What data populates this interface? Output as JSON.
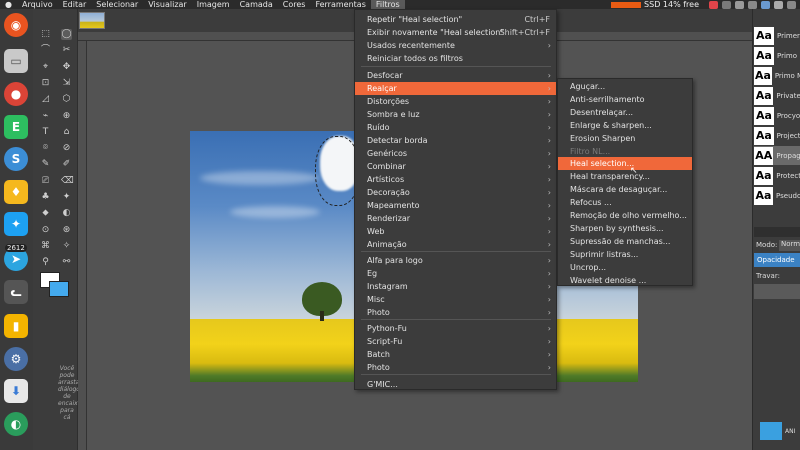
{
  "menubar": {
    "items": [
      "Arquivo",
      "Editar",
      "Selecionar",
      "Visualizar",
      "Imagem",
      "Camada",
      "Cores",
      "Ferramentas",
      "Filtros"
    ],
    "active": "Filtros"
  },
  "system": {
    "ssd_label": "SSD 14% free",
    "ssd_color": "#e85b13"
  },
  "launcher": {
    "apps": [
      "ubuntu-logo-icon",
      "files-icon",
      "chrome-icon",
      "evernote-icon",
      "simplenote-icon",
      "lightbulb-icon",
      "twitter-icon",
      "telegram-icon",
      "cat-icon",
      "slides-icon",
      "settings-icon",
      "install-icon",
      "sound-icon"
    ],
    "telegram_badge": "2612"
  },
  "toolbox": {
    "tip": "Você pode arrastar diálogos de encaixe para cá"
  },
  "filters_menu": {
    "items": [
      {
        "label": "Repetir \"Heal selection\"",
        "shortcut": "Ctrl+F",
        "submenu": false
      },
      {
        "label": "Exibir novamente \"Heal selection\"",
        "shortcut": "Shift+Ctrl+F",
        "submenu": false
      },
      {
        "label": "Usados recentemente",
        "shortcut": "",
        "submenu": true
      },
      {
        "label": "Reiniciar todos os filtros",
        "shortcut": "",
        "submenu": false
      },
      {
        "label": "Desfocar",
        "shortcut": "",
        "submenu": true
      },
      {
        "label": "Realçar",
        "shortcut": "",
        "submenu": true,
        "highlighted": true
      },
      {
        "label": "Distorções",
        "shortcut": "",
        "submenu": true
      },
      {
        "label": "Sombra e luz",
        "shortcut": "",
        "submenu": true
      },
      {
        "label": "Ruído",
        "shortcut": "",
        "submenu": true
      },
      {
        "label": "Detectar borda",
        "shortcut": "",
        "submenu": true
      },
      {
        "label": "Genéricos",
        "shortcut": "",
        "submenu": true
      },
      {
        "label": "Combinar",
        "shortcut": "",
        "submenu": true
      },
      {
        "label": "Artísticos",
        "shortcut": "",
        "submenu": true
      },
      {
        "label": "Decoração",
        "shortcut": "",
        "submenu": true
      },
      {
        "label": "Mapeamento",
        "shortcut": "",
        "submenu": true
      },
      {
        "label": "Renderizar",
        "shortcut": "",
        "submenu": true
      },
      {
        "label": "Web",
        "shortcut": "",
        "submenu": true
      },
      {
        "label": "Animação",
        "shortcut": "",
        "submenu": true
      },
      {
        "label": "Alfa para logo",
        "shortcut": "",
        "submenu": true
      },
      {
        "label": "Eg",
        "shortcut": "",
        "submenu": true
      },
      {
        "label": "Instagram",
        "shortcut": "",
        "submenu": true
      },
      {
        "label": "Misc",
        "shortcut": "",
        "submenu": true
      },
      {
        "label": "Photo",
        "shortcut": "",
        "submenu": true
      },
      {
        "label": "Python-Fu",
        "shortcut": "",
        "submenu": true
      },
      {
        "label": "Script-Fu",
        "shortcut": "",
        "submenu": true
      },
      {
        "label": "Batch",
        "shortcut": "",
        "submenu": true
      },
      {
        "label": "Photo",
        "shortcut": "",
        "submenu": true
      },
      {
        "label": "G'MIC...",
        "shortcut": "",
        "submenu": false
      }
    ]
  },
  "enhance_submenu": {
    "items": [
      {
        "label": "Aguçar...",
        "disabled": false
      },
      {
        "label": "Anti-serrilhamento",
        "disabled": false
      },
      {
        "label": "Desentrelaçar...",
        "disabled": false
      },
      {
        "label": "Enlarge & sharpen...",
        "disabled": false
      },
      {
        "label": "Erosion Sharpen",
        "disabled": false
      },
      {
        "label": "Filtro NL...",
        "disabled": true
      },
      {
        "label": "Heal selection...",
        "disabled": false,
        "highlighted": true
      },
      {
        "label": "Heal transparency...",
        "disabled": false
      },
      {
        "label": "Máscara de desaguçar...",
        "disabled": false
      },
      {
        "label": "Refocus ...",
        "disabled": false
      },
      {
        "label": "Remoção de olho vermelho...",
        "disabled": false
      },
      {
        "label": "Sharpen by synthesis...",
        "disabled": false
      },
      {
        "label": "Supressão de manchas...",
        "disabled": false
      },
      {
        "label": "Suprimir listras...",
        "disabled": false
      },
      {
        "label": "Uncrop...",
        "disabled": false
      },
      {
        "label": "Wavelet denoise ...",
        "disabled": false
      }
    ]
  },
  "fonts_panel": {
    "fonts": [
      {
        "icon": "Aa",
        "name": "Primer"
      },
      {
        "icon": "Aa",
        "name": "Primo"
      },
      {
        "icon": "Aa",
        "name": "Primo M"
      },
      {
        "icon": "Aa",
        "name": "Private"
      },
      {
        "icon": "Aa",
        "name": "Procyo"
      },
      {
        "icon": "Aa",
        "name": "Project"
      },
      {
        "icon": "AA",
        "name": "Propag"
      },
      {
        "icon": "Aa",
        "name": "Protect"
      },
      {
        "icon": "Aa",
        "name": "Pseudo"
      }
    ],
    "selected_index": 6
  },
  "layers_panel": {
    "mode_label": "Modo:",
    "mode_value": "Norm",
    "opacity_label": "Opacidade",
    "lock_label": "Travar:",
    "layer_name": "ANI"
  },
  "accent_color": "#f0683a"
}
